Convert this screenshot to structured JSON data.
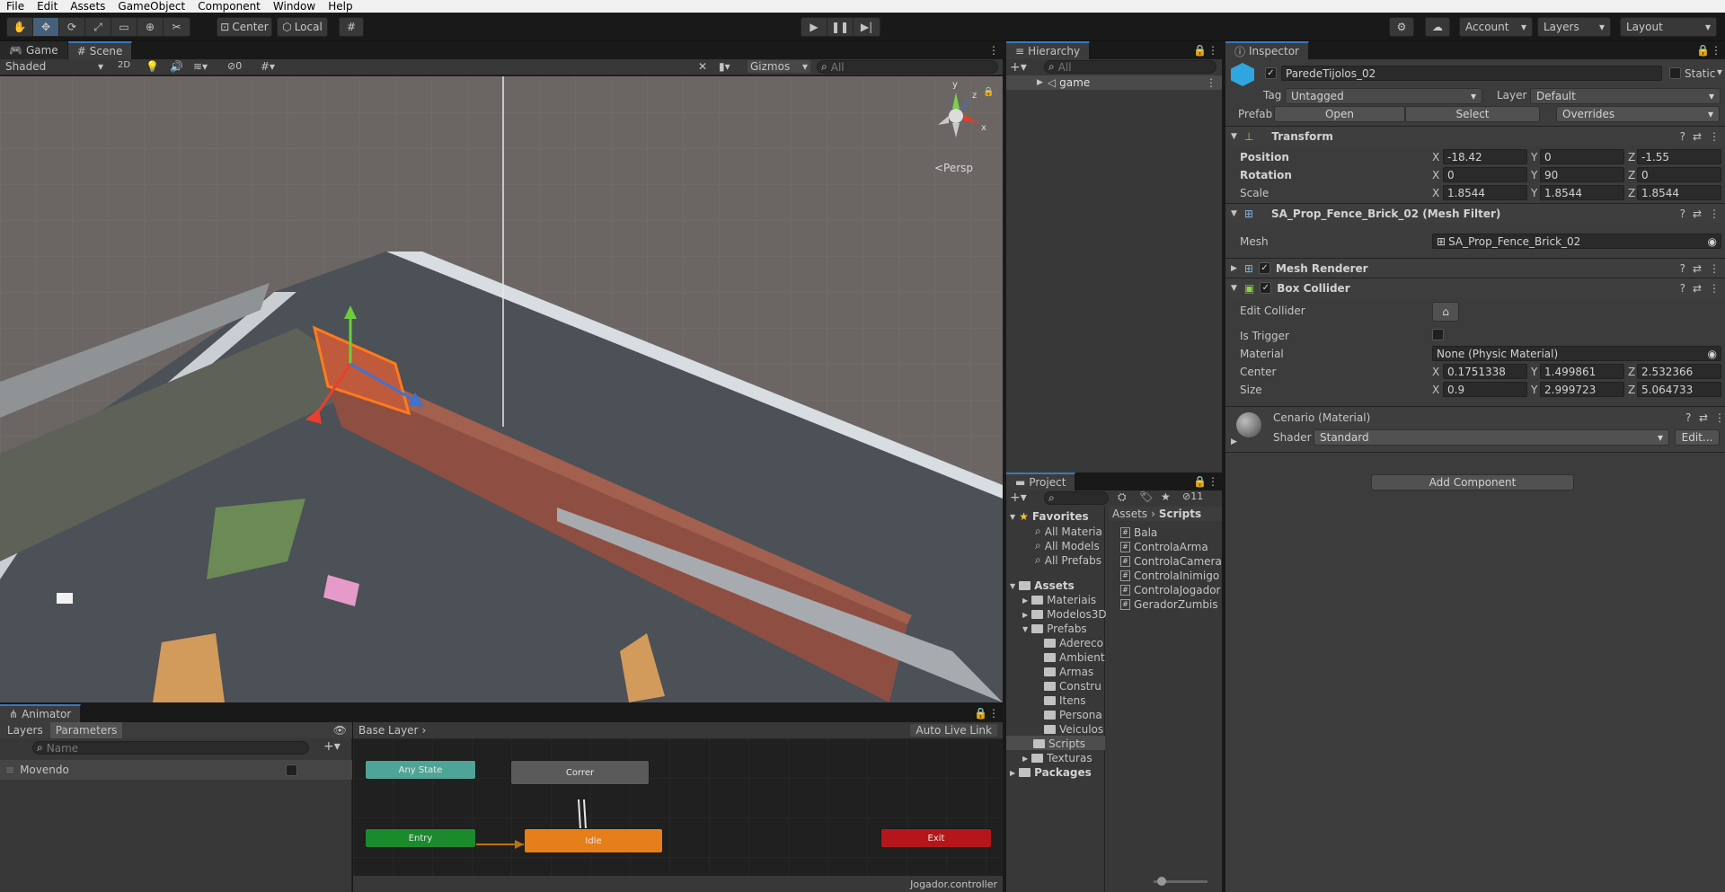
{
  "menu": [
    "File",
    "Edit",
    "Assets",
    "GameObject",
    "Component",
    "Window",
    "Help"
  ],
  "toolbar": {
    "center_label": "Center",
    "local_label": "Local",
    "account_label": "Account",
    "layers_label": "Layers",
    "layout_label": "Layout"
  },
  "scene": {
    "tabs": [
      "Game",
      "Scene"
    ],
    "shading": "Shaded",
    "mode2d": "2D",
    "hidden_count": "0",
    "gizmos_label": "Gizmos",
    "search_placeholder": "All",
    "persp_label": "<Persp",
    "axis_x": "x",
    "axis_y": "y",
    "axis_z": "z"
  },
  "hierarchy": {
    "tab": "Hierarchy",
    "search_placeholder": "All",
    "root": "game"
  },
  "project": {
    "tab": "Project",
    "hidden_count": "11",
    "favorites_label": "Favorites",
    "favorites": [
      "All Materia",
      "All Models",
      "All Prefabs"
    ],
    "assets_label": "Assets",
    "assets_children": [
      "Materiais",
      "Modelos3D",
      "Prefabs"
    ],
    "prefabs_children": [
      "Adereco",
      "Ambient",
      "Armas",
      "Constru",
      "Itens",
      "Persona",
      "Veiculos"
    ],
    "after_prefabs": [
      "Scripts",
      "Texturas"
    ],
    "packages_label": "Packages",
    "breadcrumb": [
      "Assets",
      "Scripts"
    ],
    "scripts": [
      "Bala",
      "ControlaArma",
      "ControlaCamera",
      "ControlaInimigo",
      "ControlaJogador",
      "GeradorZumbis"
    ]
  },
  "inspector": {
    "tab": "Inspector",
    "object_name": "ParedeTijolos_02",
    "static_label": "Static",
    "tag_label": "Tag",
    "tag_value": "Untagged",
    "layer_label": "Layer",
    "layer_value": "Default",
    "prefab_label": "Prefab",
    "open_label": "Open",
    "select_label": "Select",
    "overrides_label": "Overrides",
    "transform": {
      "title": "Transform",
      "position_label": "Position",
      "position": [
        "-18.42",
        "0",
        "-1.55"
      ],
      "rotation_label": "Rotation",
      "rotation": [
        "0",
        "90",
        "0"
      ],
      "scale_label": "Scale",
      "scale": [
        "1.8544",
        "1.8544",
        "1.8544"
      ]
    },
    "mesh_filter": {
      "title": "SA_Prop_Fence_Brick_02 (Mesh Filter)",
      "mesh_label": "Mesh",
      "mesh_value": "SA_Prop_Fence_Brick_02"
    },
    "mesh_renderer": {
      "title": "Mesh Renderer"
    },
    "box_collider": {
      "title": "Box Collider",
      "edit_label": "Edit Collider",
      "trigger_label": "Is Trigger",
      "material_label": "Material",
      "material_value": "None (Physic Material)",
      "center_label": "Center",
      "center": [
        "0.1751338",
        "1.499861",
        "2.532366"
      ],
      "size_label": "Size",
      "size": [
        "0.9",
        "2.999723",
        "5.064733"
      ]
    },
    "material": {
      "title": "Cenario (Material)",
      "shader_label": "Shader",
      "shader_value": "Standard",
      "edit_label": "Edit..."
    },
    "add_component": "Add Component",
    "x": "X",
    "y": "Y",
    "z": "Z"
  },
  "animator": {
    "tab": "Animator",
    "layers_tab": "Layers",
    "parameters_tab": "Parameters",
    "search_placeholder": "Name",
    "param": "Movendo",
    "base_layer": "Base Layer",
    "auto_live_link": "Auto Live Link",
    "nodes": {
      "any_state": "Any State",
      "correr": "Correr",
      "entry": "Entry",
      "idle": "Idle",
      "exit": "Exit"
    },
    "controller": "Jogador.controller"
  },
  "colors": {
    "accent": "#3a79bb",
    "idle": "#e67e1a",
    "entry": "#1b8a2d",
    "exit": "#b5161b",
    "any_state": "#4ea597"
  }
}
